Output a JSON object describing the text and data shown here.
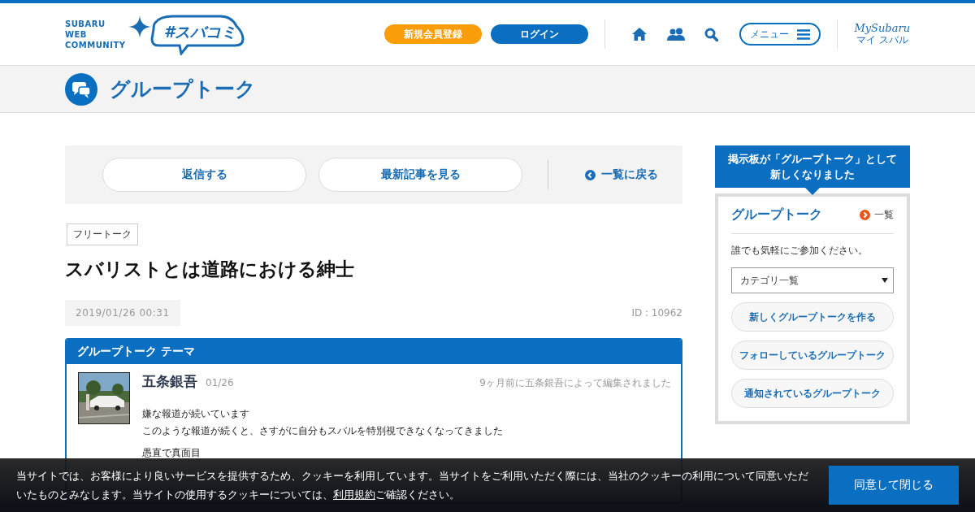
{
  "header": {
    "logo_lines": [
      "SUBARU",
      "WEB",
      "COMMUNITY"
    ],
    "logo_text": "#スバコミ",
    "register_button": "新規会員登録",
    "login_button": "ログイン",
    "menu_button": "メニュー",
    "mysubaru": "MySubaru",
    "mysubaru_kana": "マイ スバル"
  },
  "page_title": "グループトーク",
  "actions": {
    "buttons": [
      "返信する",
      "最新記事を見る"
    ],
    "back_link": "一覧に戻る"
  },
  "post": {
    "tag": "フリートーク",
    "title": "スバリストとは道路における紳士",
    "date": "2019/01/26 00:31",
    "id": "ID : 10962",
    "theme": {
      "heading": "グループトーク テーマ",
      "author": "五条銀吾",
      "date": "01/26",
      "edited": "9ヶ月前に五条銀吾によって編集されました",
      "lines": [
        "嫌な報道が続いています",
        "このような報道が続くと、さすがに自分もスバルを特別視できなくなってきました",
        "愚直で真面目"
      ]
    }
  },
  "sidebar": {
    "notice": "掲示板が「グループトーク」として新しくなりました",
    "title": "グループトーク",
    "more_link": "一覧",
    "description": "誰でも気軽にご参加ください。",
    "select": "カテゴリ一覧",
    "buttons": [
      "新しくグループトークを作る",
      "フォローしているグループトーク",
      "通知されているグループトーク"
    ]
  },
  "cookie": {
    "text_before": "当サイトでは、お客様により良いサービスを提供するため、クッキーを利用しています。当サイトをご利用いただく際には、当社のクッキーの利用について同意いただいたものとみなします。当サイトの使用するクッキーについては、",
    "link": "利用規約",
    "text_after": "ご確認ください。",
    "button": "同意して閉じる"
  }
}
